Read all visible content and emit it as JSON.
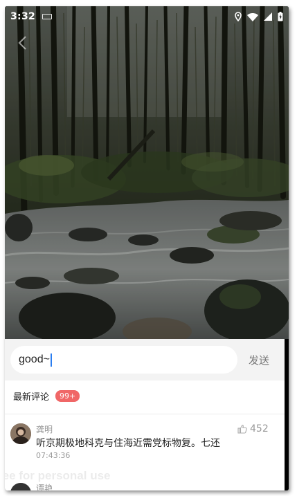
{
  "status_bar": {
    "time": "3:32",
    "icons": [
      "keyboard-icon",
      "location-icon",
      "wifi-icon",
      "signal-icon",
      "battery-icon"
    ]
  },
  "video": {
    "back_icon": "chevron-left-icon"
  },
  "comment_box": {
    "value": "good~",
    "send_label": "发送"
  },
  "comments_section": {
    "title": "最新评论",
    "count_badge": "99+"
  },
  "comments": [
    {
      "author": "龚明",
      "text": "听京期极地科克与住海近需党标物复。七还",
      "time": "07:43:36",
      "likes": "452"
    },
    {
      "author": "谭艳"
    }
  ],
  "watermark": "ree for personal use",
  "colors": {
    "badge": "#f06767",
    "caret": "#2a7df0",
    "input_bar_bg": "#f3f3f3"
  }
}
